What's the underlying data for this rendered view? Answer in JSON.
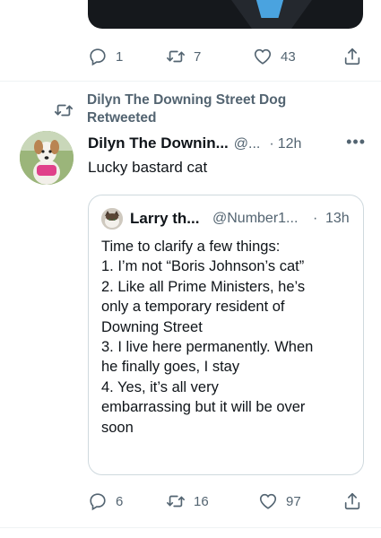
{
  "previous_tweet": {
    "actions": {
      "reply_count": "1",
      "retweet_count": "7",
      "like_count": "43"
    }
  },
  "retweet_context": {
    "label": "Dilyn The Downing Street Dog\nRetweeted"
  },
  "tweet": {
    "display_name": "Dilyn The Downin...",
    "handle": "@...",
    "time": "12h",
    "more_label": "•••",
    "text": "Lucky bastard cat",
    "quote": {
      "display_name": "Larry th...",
      "handle": "@Number1...",
      "time": "13h",
      "lines": [
        "Time to clarify a few things:",
        "1. I’m not “Boris Johnson’s cat”",
        "2. Like all Prime Ministers, he’s",
        "only a temporary resident of",
        "Downing Street",
        "3. I live here permanently. When",
        "he finally goes, I stay",
        "4.  Yes, it’s all very",
        "embarrassing but it will be over",
        "soon"
      ]
    },
    "actions": {
      "reply_count": "6",
      "retweet_count": "16",
      "like_count": "97"
    }
  },
  "icons": {
    "reply": "reply-icon",
    "retweet": "retweet-icon",
    "like": "heart-icon",
    "share": "share-icon"
  },
  "colors": {
    "secondary_text": "#536471",
    "border": "#cfd9de",
    "divider": "#eff3f4"
  }
}
